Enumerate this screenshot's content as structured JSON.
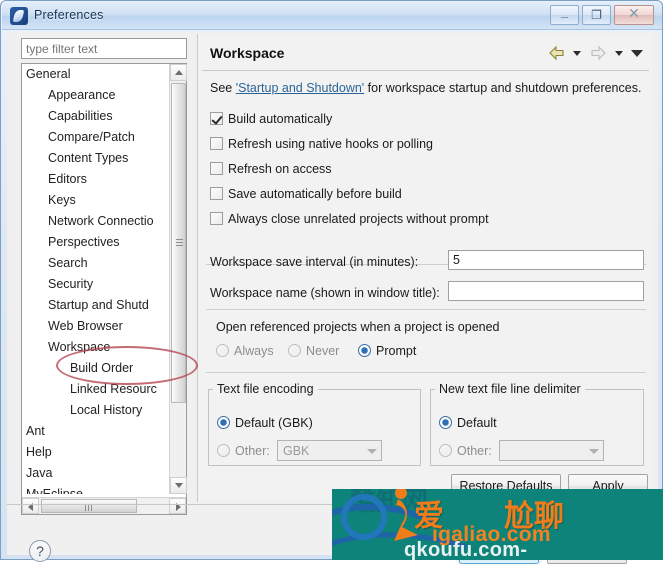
{
  "window": {
    "title": "Preferences",
    "icon": "eclipse-icon",
    "controls": {
      "minimize": "–",
      "maximize": "❐",
      "close": "✕"
    }
  },
  "sidebar": {
    "filter": {
      "placeholder": "type filter text",
      "value": ""
    },
    "tree": [
      {
        "label": "General",
        "level": 0
      },
      {
        "label": "Appearance",
        "level": 1
      },
      {
        "label": "Capabilities",
        "level": 1
      },
      {
        "label": "Compare/Patch",
        "level": 1
      },
      {
        "label": "Content Types",
        "level": 1
      },
      {
        "label": "Editors",
        "level": 1
      },
      {
        "label": "Keys",
        "level": 1
      },
      {
        "label": "Network Connectio",
        "level": 1
      },
      {
        "label": "Perspectives",
        "level": 1
      },
      {
        "label": "Search",
        "level": 1
      },
      {
        "label": "Security",
        "level": 1
      },
      {
        "label": "Startup and Shutd",
        "level": 1
      },
      {
        "label": "Web Browser",
        "level": 1
      },
      {
        "label": "Workspace",
        "level": 1
      },
      {
        "label": "Build Order",
        "level": 2
      },
      {
        "label": "Linked Resourc",
        "level": 2
      },
      {
        "label": "Local History",
        "level": 2
      },
      {
        "label": "Ant",
        "level": 0
      },
      {
        "label": "Help",
        "level": 0
      },
      {
        "label": "Java",
        "level": 0
      },
      {
        "label": "MyEclipse",
        "level": 0
      }
    ],
    "annotation": {
      "shape": "ellipse",
      "target": "Workspace",
      "color": "#b5414f"
    }
  },
  "page": {
    "title": "Workspace",
    "nav": {
      "back": "back-arrow",
      "back_menu": "chevron-down",
      "forward": "forward-arrow",
      "forward_menu": "chevron-down",
      "view_menu": "chevron-down"
    },
    "see_prefix": "See ",
    "see_link": "'Startup and Shutdown'",
    "see_suffix": " for workspace startup and shutdown preferences.",
    "checkboxes": [
      {
        "label": "Build automatically",
        "checked": true
      },
      {
        "label": "Refresh using native hooks or polling",
        "checked": false
      },
      {
        "label": "Refresh on access",
        "checked": false
      },
      {
        "label": "Save automatically before build",
        "checked": false
      },
      {
        "label": "Always close unrelated projects without prompt",
        "checked": false
      }
    ],
    "fields": [
      {
        "label": "Workspace save interval (in minutes):",
        "value": "5"
      },
      {
        "label": "Workspace name (shown in window title):",
        "value": ""
      }
    ],
    "open_referenced": {
      "label": "Open referenced projects when a project is opened",
      "options": [
        {
          "label": "Always",
          "selected": false
        },
        {
          "label": "Never",
          "selected": false
        },
        {
          "label": "Prompt",
          "selected": true
        }
      ]
    },
    "encoding_group": {
      "legend": "Text file encoding",
      "default_label": "Default (GBK)",
      "default_selected": true,
      "other_label": "Other:",
      "other_selected": false,
      "other_value": "GBK"
    },
    "delimiter_group": {
      "legend": "New text file line delimiter",
      "default_label": "Default",
      "default_selected": true,
      "other_label": "Other:",
      "other_selected": false,
      "other_value": ""
    },
    "restore_defaults_label": "Restore Defaults",
    "apply_label": "Apply"
  },
  "footer": {
    "help_icon": "question-mark-icon",
    "ok_label": "",
    "cancel_label": ""
  },
  "watermark": {
    "cn_left": "爱",
    "cn_right": "尬聊",
    "domain_orange": "igaliao.com",
    "domain_white": "qkoufu.com-",
    "ghost_text": "酷知网",
    "bg_color": "#0d8379",
    "accent_color": "#f07c1a"
  }
}
